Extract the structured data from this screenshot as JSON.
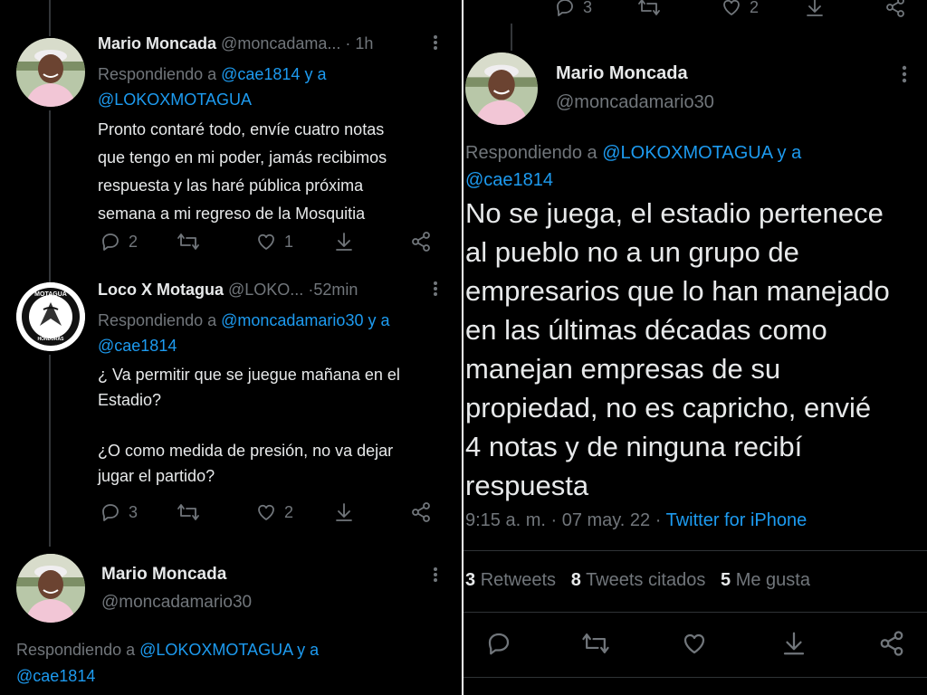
{
  "left": {
    "tweet1": {
      "name": "Mario Moncada",
      "handle": "@moncadama...",
      "sep": "·",
      "time": "1h",
      "replying_prefix": "Respondiendo a ",
      "replying_1": "@cae1814",
      "replying_and": " y a",
      "replying_2": "@LOKOXMOTAGUA",
      "text": "Pronto contaré todo, envíe cuatro notas\nque tengo en mi poder, jamás recibimos\nrespuesta  y las haré pública próxima\nsemana a mi regreso de la Mosquitia",
      "replies": "2",
      "likes": "1"
    },
    "tweet2": {
      "name": "Loco X Motagua",
      "handle": "@LOKO...",
      "sep": "·",
      "time": "52min",
      "logo_text_top": "MOTAGUA",
      "logo_text_bottom": "HONDURAS",
      "replying_prefix": "Respondiendo a ",
      "replying_1": "@moncadamario30",
      "replying_and": " y a",
      "replying_2": "@cae1814",
      "text": "¿ Va permitir que se juegue mañana en el\nEstadio?\n\n¿O como medida de presión, no va dejar\njugar el partido?",
      "replies": "3",
      "likes": "2"
    },
    "tweet3": {
      "name": "Mario Moncada",
      "handle": "@moncadamario30",
      "replying_prefix": "Respondiendo a ",
      "replying_1": "@LOKOXMOTAGUA",
      "replying_and": " y a",
      "replying_2": "@cae1814"
    }
  },
  "right": {
    "top_actions": {
      "replies": "3",
      "likes": "2"
    },
    "tweet": {
      "name": "Mario Moncada",
      "handle": "@moncadamario30",
      "replying_prefix": "Respondiendo a ",
      "replying_1": "@LOKOXMOTAGUA",
      "replying_and": " y a",
      "replying_2": "@cae1814",
      "text": "No se juega, el estadio pertenece\nal pueblo no a un grupo de\nempresarios que lo han manejado\nen las últimas décadas como\nmanejan empresas de su\npropiedad, no es capricho, envié\n4 notas y de ninguna recibí\nrespuesta",
      "time": "9:15 a. m. · 07 may. 22 · ",
      "source": "Twitter for iPhone"
    },
    "stats": {
      "retweets_count": "3",
      "retweets_label": "Retweets",
      "quotes_count": "8",
      "quotes_label": "Tweets citados",
      "likes_count": "5",
      "likes_label": "Me gusta"
    }
  },
  "colors": {
    "background": "#000000",
    "text": "#e7e9ea",
    "muted": "#71767b",
    "link": "#1d9bf0",
    "divider": "#2f3336"
  },
  "icons": [
    "reply-icon",
    "retweet-icon",
    "like-icon",
    "download-icon",
    "share-icon",
    "more-icon"
  ]
}
